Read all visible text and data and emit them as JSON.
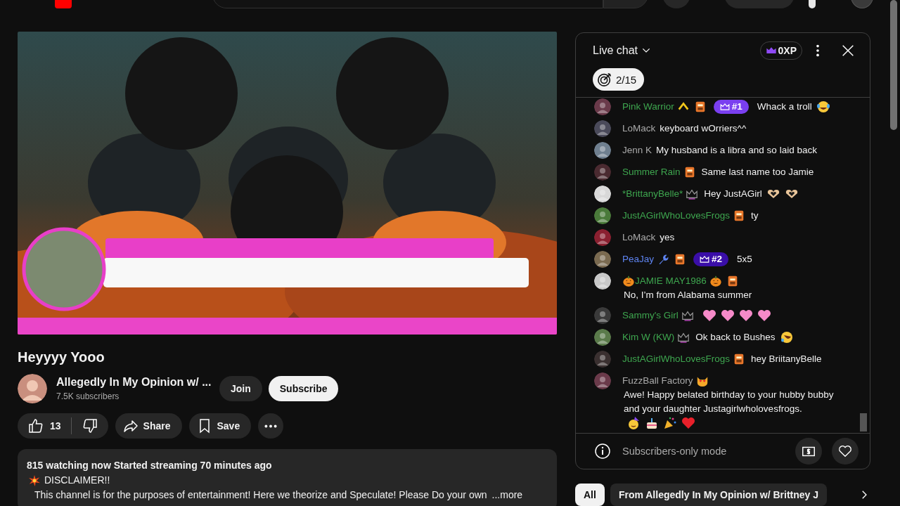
{
  "video": {
    "title": "Heyyyy Yooo"
  },
  "channel": {
    "name": "Allegedly In My Opinion w/ ...",
    "subscribers": "7.5K subscribers",
    "join_label": "Join",
    "subscribe_label": "Subscribe"
  },
  "actions": {
    "likes": "13",
    "share": "Share",
    "save": "Save"
  },
  "description": {
    "stats": "815 watching now  Started streaming 70 minutes ago",
    "heading": "DISCLAIMER!!",
    "body": "This channel is for the purposes of entertainment!  Here we theorize and Speculate!  Please Do your own",
    "more": "...more"
  },
  "chat": {
    "title": "Live chat",
    "xp": "0XP",
    "goal": "2/15",
    "footer": "Subscribers-only mode",
    "messages": [
      {
        "author": "Pink Warrior",
        "color": "#3ea64f",
        "badges": [
          {
            "kind": "chevron"
          },
          {
            "kind": "member"
          }
        ],
        "rank": {
          "label": "#1",
          "color": "#7a3ff0"
        },
        "text": "Whack a troll",
        "emojis": [
          {
            "kind": "laugh"
          }
        ]
      },
      {
        "author": "LoMack",
        "color": "#aaaaaa",
        "text": "keyboard wOrriers^^"
      },
      {
        "author": "Jenn K",
        "color": "#aaaaaa",
        "text": "My husband is a libra and so laid back"
      },
      {
        "author": "Summer Rain",
        "color": "#3ea64f",
        "badges": [
          {
            "kind": "member"
          }
        ],
        "text": "Same last name too Jamie"
      },
      {
        "author": "*BrittanyBelle*",
        "color": "#3ea64f",
        "badges": [
          {
            "kind": "crown"
          }
        ],
        "text": "Hey JustAGirl",
        "emojis": [
          {
            "kind": "heart-hands"
          },
          {
            "kind": "heart-hands"
          }
        ]
      },
      {
        "author": "JustAGirlWhoLovesFrogs",
        "color": "#3ea64f",
        "badges": [
          {
            "kind": "member"
          }
        ],
        "text": "ty"
      },
      {
        "author": "LoMack",
        "color": "#aaaaaa",
        "text": "yes"
      },
      {
        "author": "PeaJay",
        "color": "#5e84f1",
        "badges": [
          {
            "kind": "wrench"
          },
          {
            "kind": "member"
          }
        ],
        "rank": {
          "label": "#2",
          "color": "#3a0ea8"
        },
        "text": "5x5"
      },
      {
        "author": "JAMIE MAY1986",
        "color": "#3ea64f",
        "before": [
          {
            "kind": "pumpkin"
          }
        ],
        "badges": [
          {
            "kind": "pumpkin"
          },
          {
            "kind": "member"
          }
        ],
        "text": "No, I’m from Alabama summer"
      },
      {
        "author": "Sammy's Girl",
        "color": "#3ea64f",
        "badges": [
          {
            "kind": "crown"
          }
        ],
        "emojis": [
          {
            "kind": "pink-heart"
          },
          {
            "kind": "pink-heart"
          },
          {
            "kind": "pink-heart"
          },
          {
            "kind": "pink-heart"
          }
        ]
      },
      {
        "author": "Kim W (KW)",
        "color": "#3ea64f",
        "badges": [
          {
            "kind": "crown"
          }
        ],
        "text": "Ok back to Bushes",
        "emojis": [
          {
            "kind": "rofl"
          }
        ]
      },
      {
        "author": "JustAGirlWhoLovesFrogs",
        "color": "#3ea64f",
        "badges": [
          {
            "kind": "member"
          }
        ],
        "text": "hey BriitanyBelle"
      },
      {
        "author": "FuzzBall Factory",
        "color": "#aaaaaa",
        "badges": [
          {
            "kind": "cat"
          }
        ],
        "text": "Awe! Happy belated birthday to your hubby bubby and your daughter Justagirlwholovesfrogs.",
        "emojis": [
          {
            "kind": "party-face"
          },
          {
            "kind": "cake"
          },
          {
            "kind": "party-popper"
          },
          {
            "kind": "red-heart"
          }
        ]
      }
    ]
  },
  "chips": [
    {
      "label": "All",
      "selected": true
    },
    {
      "label": "From Allegedly In My Opinion w/ Brittney J",
      "selected": false
    }
  ]
}
